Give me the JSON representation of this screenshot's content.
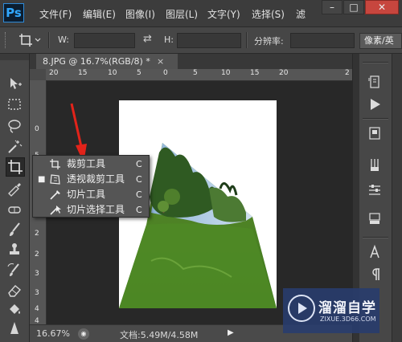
{
  "app": {
    "logo": "Ps",
    "menus": [
      "文件(F)",
      "编辑(E)",
      "图像(I)",
      "图层(L)",
      "文字(Y)",
      "选择(S)",
      "滤"
    ],
    "window_controls": [
      "minimize-icon",
      "restore-icon",
      "close-icon"
    ]
  },
  "options_bar": {
    "width_label": "W:",
    "height_label": "H:",
    "resolution_label": "分辨率:",
    "unit_value": "像素/英",
    "width_value": "",
    "height_value": "",
    "resolution_value": ""
  },
  "document": {
    "tab_title": "8.JPG @ 16.7%(RGB/8) *",
    "tab_close": "×",
    "zoom": "16.67%",
    "doc_size": "文档:5.49M/4.58M",
    "ruler_h_ticks": [
      "20",
      "15",
      "10",
      "5",
      "0",
      "5",
      "10",
      "15",
      "20",
      "2"
    ],
    "ruler_v_ticks": [
      "0",
      "5",
      "1",
      "1",
      "2",
      "2",
      "3",
      "3",
      "4",
      "4"
    ]
  },
  "tools": [
    "move-tool",
    "marquee-tool",
    "lasso-tool",
    "magic-wand-tool",
    "crop-tool",
    "eyedropper-tool",
    "spot-healing-tool",
    "brush-tool",
    "clone-stamp-tool",
    "history-brush-tool",
    "eraser-tool",
    "paint-bucket-tool",
    "sharpen-tool"
  ],
  "flyout": {
    "items": [
      {
        "label": "裁剪工具",
        "shortcut": "C",
        "selected": false
      },
      {
        "label": "透视裁剪工具",
        "shortcut": "C",
        "selected": true
      },
      {
        "label": "切片工具",
        "shortcut": "C",
        "selected": false
      },
      {
        "label": "切片选择工具",
        "shortcut": "C",
        "selected": false
      }
    ],
    "selected_bullet": "■"
  },
  "right_dock": [
    "history-panel-icon",
    "actions-play-icon",
    "properties-icon",
    "brush-presets-icon",
    "adjustments-icon",
    "layers-icon",
    "character-icon",
    "paragraph-icon"
  ],
  "watermark": {
    "title": "溜溜自学",
    "url": "ZIXUE.3D66.COM"
  },
  "colors": {
    "ps_blue": "#31a8ff",
    "annotation_red": "#e2231a",
    "close_button": "#c7463e"
  }
}
